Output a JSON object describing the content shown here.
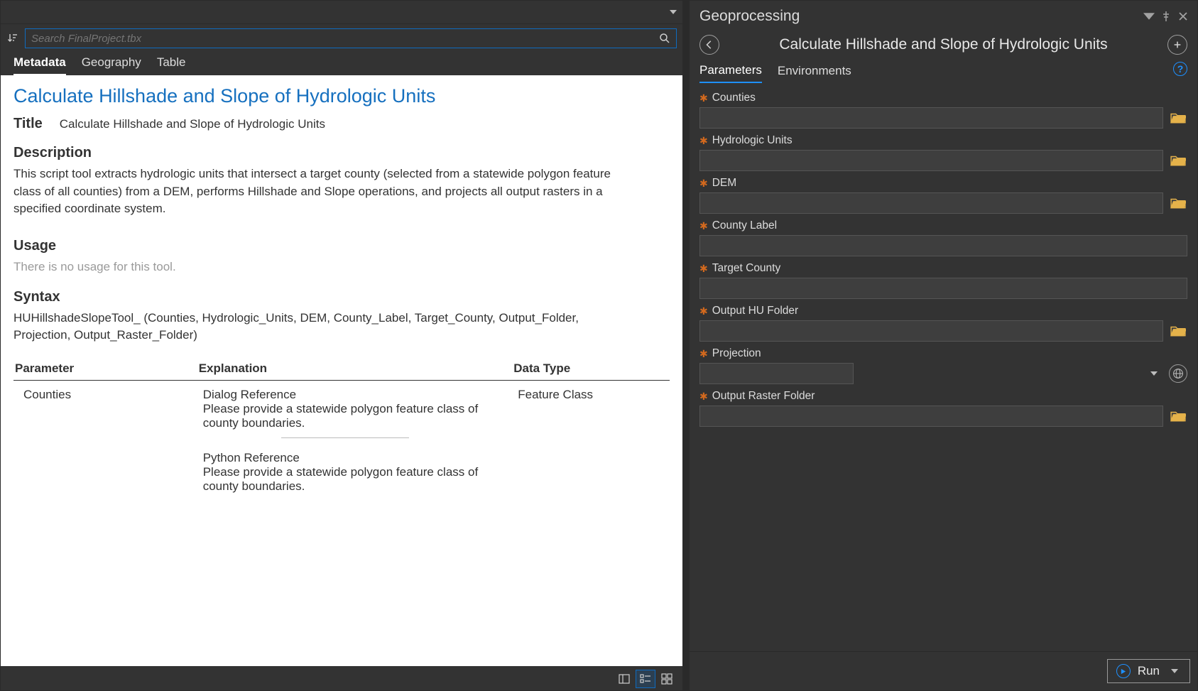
{
  "left": {
    "search_placeholder": "Search FinalProject.tbx",
    "tabs": [
      "Metadata",
      "Geography",
      "Table"
    ],
    "active_tab": 0
  },
  "metadata": {
    "heading": "Calculate Hillshade and Slope of Hydrologic Units",
    "title_label": "Title",
    "title_value": "Calculate Hillshade and Slope of Hydrologic Units",
    "description_label": "Description",
    "description_text": "This script tool extracts hydrologic units that intersect a target county (selected from a statewide polygon feature class of all counties) from a DEM, performs Hillshade and Slope operations, and projects all output rasters in a specified coordinate system.",
    "usage_label": "Usage",
    "usage_text": "There is no usage for this tool.",
    "syntax_label": "Syntax",
    "syntax_text": "HUHillshadeSlopeTool_ (Counties, Hydrologic_Units, DEM, County_Label, Target_County, Output_Folder, Projection, Output_Raster_Folder)",
    "table": {
      "headers": [
        "Parameter",
        "Explanation",
        "Data Type"
      ],
      "rows": [
        {
          "param": "Counties",
          "dialog_ref_label": "Dialog Reference",
          "dialog_ref_text": "Please provide a statewide polygon feature class of county boundaries.",
          "python_ref_label": "Python Reference",
          "python_ref_text": "Please provide a statewide polygon feature class of county boundaries.",
          "type": "Feature Class"
        }
      ]
    }
  },
  "right": {
    "panel_title": "Geoprocessing",
    "tool_title": "Calculate Hillshade and Slope of Hydrologic Units",
    "tabs": [
      "Parameters",
      "Environments"
    ],
    "active_tab": 0,
    "params": [
      {
        "label": "Counties",
        "browse": true
      },
      {
        "label": "Hydrologic Units",
        "browse": true
      },
      {
        "label": "DEM",
        "browse": true
      },
      {
        "label": "County Label",
        "browse": false
      },
      {
        "label": "Target County",
        "browse": false
      },
      {
        "label": "Output HU Folder",
        "browse": true
      },
      {
        "label": "Projection",
        "browse": false,
        "projection": true
      },
      {
        "label": "Output Raster Folder",
        "browse": true
      }
    ],
    "run_label": "Run"
  }
}
